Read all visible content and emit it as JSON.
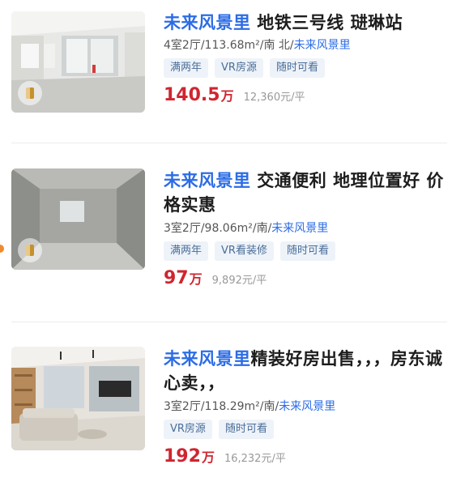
{
  "listings": [
    {
      "community": "未来风景里",
      "title_rest": " 地铁三号线 琎琳站",
      "layout": "4室2厅/113.68m²/南 北/",
      "community_link": "未来风景里",
      "tags": [
        "满两年",
        "VR房源",
        "随时可看"
      ],
      "price": "140.5",
      "price_unit": "万",
      "unit_price": "12,360元/平",
      "thumbnail": "empty-apartment-photo"
    },
    {
      "community": "未来风景里",
      "title_rest": " 交通便利 地理位置好 价格实惠",
      "layout": "3室2厅/98.06m²/南/",
      "community_link": "未来风景里",
      "tags": [
        "满两年",
        "VR看装修",
        "随时可看"
      ],
      "price": "97",
      "price_unit": "万",
      "unit_price": "9,892元/平",
      "thumbnail": "bare-concrete-room-photo"
    },
    {
      "community": "未来风景里",
      "title_rest": "精装好房出售，，，房东诚心卖，，",
      "layout": "3室2厅/118.29m²/南/",
      "community_link": "未来风景里",
      "tags": [
        "VR房源",
        "随时可看"
      ],
      "price": "192",
      "price_unit": "万",
      "unit_price": "16,232元/平",
      "thumbnail": "furnished-living-room-photo"
    }
  ],
  "colors": {
    "accent_blue": "#2c6ce6",
    "price_red": "#d02530",
    "tag_bg": "#eef3f9",
    "tag_text": "#4a6d99"
  },
  "icons": {
    "vr_badge": "vr-door-icon"
  }
}
